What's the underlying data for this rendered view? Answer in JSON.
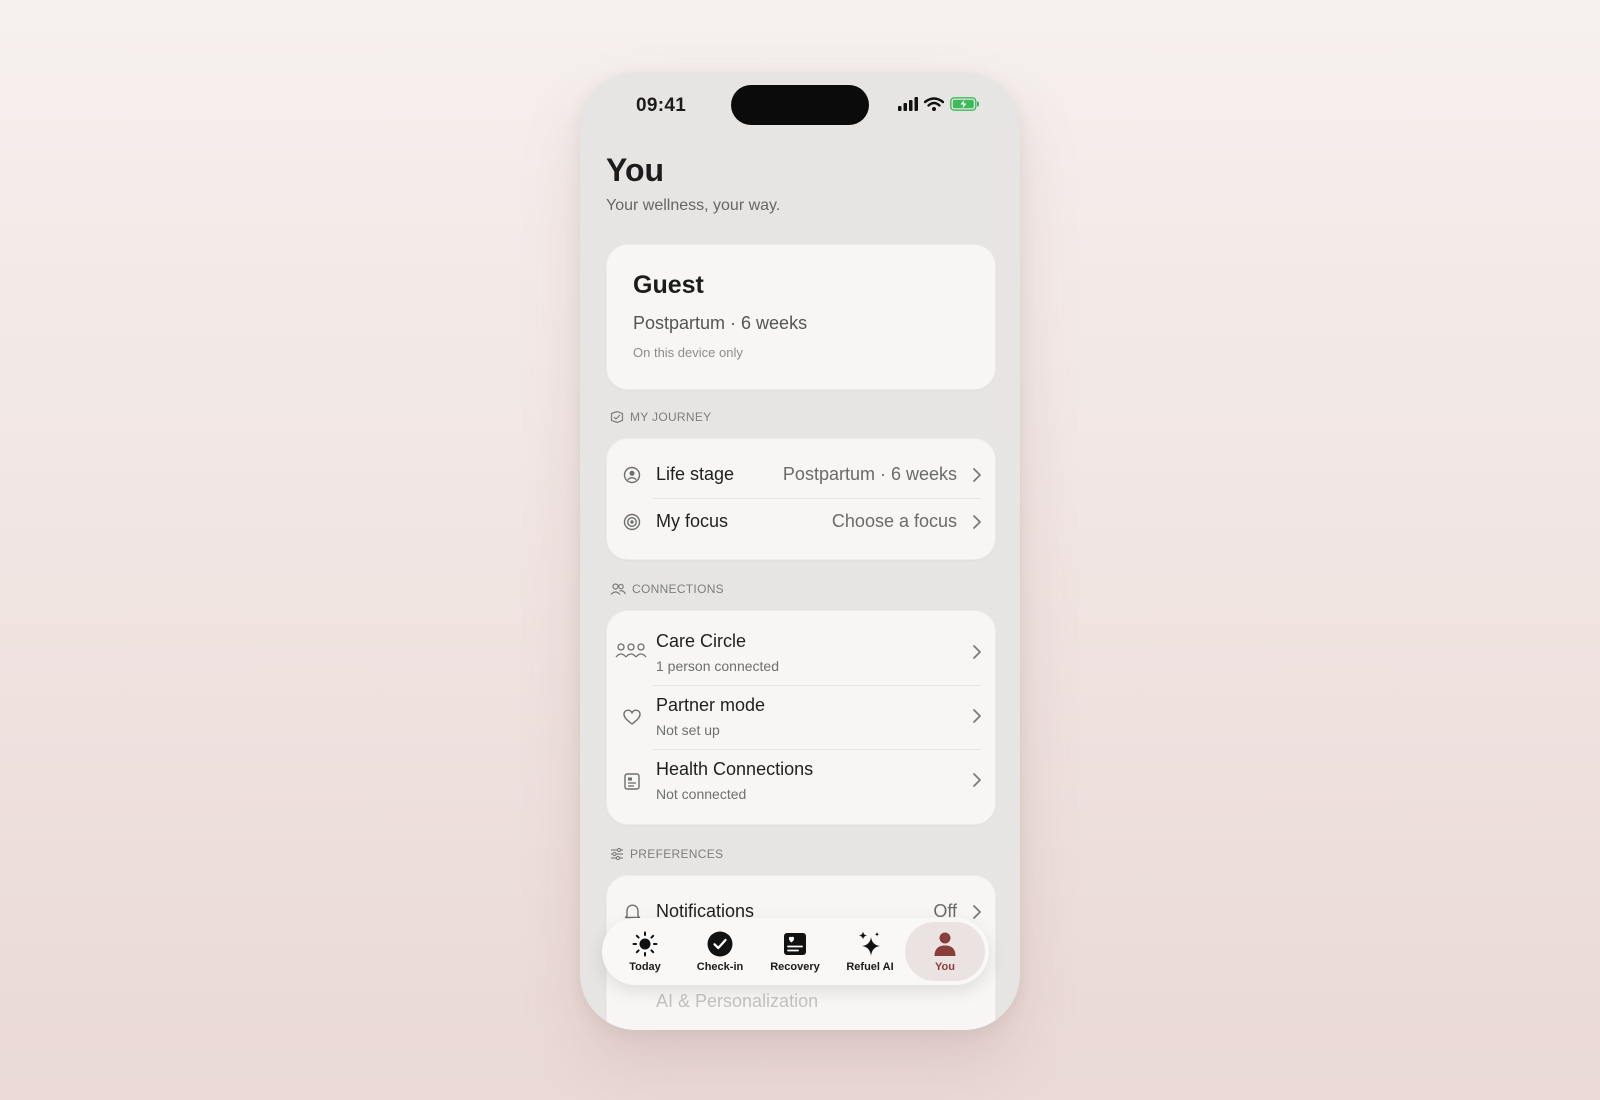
{
  "status_bar": {
    "time": "09:41"
  },
  "header": {
    "title": "You",
    "subtitle": "Your wellness, your way."
  },
  "profile": {
    "name": "Guest",
    "stage": "Postpartum · 6 weeks",
    "note": "On this device only"
  },
  "sections": {
    "journey": {
      "title": "MY JOURNEY",
      "items": [
        {
          "label": "Life stage",
          "value": "Postpartum · 6 weeks",
          "icon": "person-circle-icon"
        },
        {
          "label": "My focus",
          "value": "Choose a focus",
          "icon": "target-icon"
        }
      ]
    },
    "connections": {
      "title": "CONNECTIONS",
      "items": [
        {
          "label": "Care Circle",
          "subtitle": "1 person connected",
          "icon": "group-icon"
        },
        {
          "label": "Partner mode",
          "subtitle": "Not set up",
          "icon": "heart-icon"
        },
        {
          "label": "Health Connections",
          "subtitle": "Not connected",
          "icon": "health-record-icon"
        }
      ]
    },
    "preferences": {
      "title": "PREFERENCES",
      "items": [
        {
          "label": "Notifications",
          "value": "Off",
          "icon": "bell-icon"
        },
        {
          "label": "AI & Personalization",
          "icon": "sparkle-icon"
        }
      ]
    }
  },
  "tab_bar": {
    "tabs": [
      {
        "label": "Today",
        "icon": "sun-icon"
      },
      {
        "label": "Check-in",
        "icon": "check-circle-icon"
      },
      {
        "label": "Recovery",
        "icon": "recovery-card-icon"
      },
      {
        "label": "Refuel AI",
        "icon": "sparkles-icon"
      },
      {
        "label": "You",
        "icon": "person-icon",
        "active": true
      }
    ]
  },
  "colors": {
    "accent": "#8a3e3b",
    "battery": "#3dbb5a",
    "card": "#f7f6f4",
    "phone_bg": "#e6e5e3"
  }
}
